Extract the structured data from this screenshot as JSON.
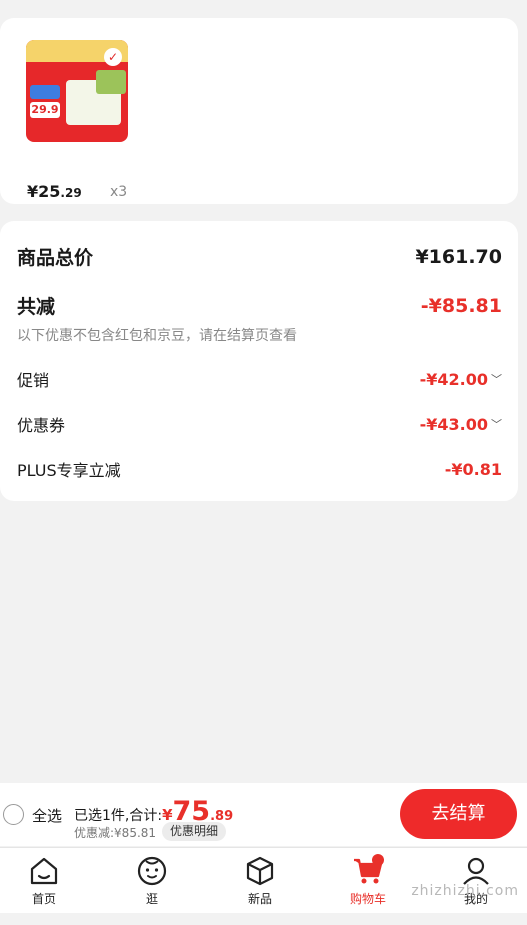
{
  "product": {
    "price_int": "¥25",
    "price_dec": ".29",
    "quantity": "x3",
    "thumb_price": "29.9"
  },
  "summary": {
    "total_label": "商品总价",
    "total_value": "¥161.70",
    "reduce_label": "共减",
    "reduce_value": "-¥85.81",
    "note": "以下优惠不包含红包和京豆，请在结算页查看",
    "promo_label": "促销",
    "promo_value": "-¥42.00",
    "coupon_label": "优惠券",
    "coupon_value": "-¥43.00",
    "plus_label": "PLUS专享立减",
    "plus_value": "-¥0.81"
  },
  "checkout": {
    "select_all": "全选",
    "selected_text": "已选1件,合计:",
    "currency": "¥",
    "amount_int": "75",
    "amount_dec": ".89",
    "discount_text": "优惠减:¥85.81",
    "detail_button": "优惠明细",
    "checkout_button": "去结算"
  },
  "tabs": [
    {
      "label": "首页",
      "icon": "home-icon"
    },
    {
      "label": "逛",
      "icon": "face-icon"
    },
    {
      "label": "新品",
      "icon": "box-icon"
    },
    {
      "label": "购物车",
      "icon": "cart-icon"
    },
    {
      "label": "我的",
      "icon": "user-icon"
    }
  ],
  "watermark": "zhizhizhi.com",
  "colors": {
    "accent": "#e8302a",
    "background": "#f2f2f2"
  }
}
